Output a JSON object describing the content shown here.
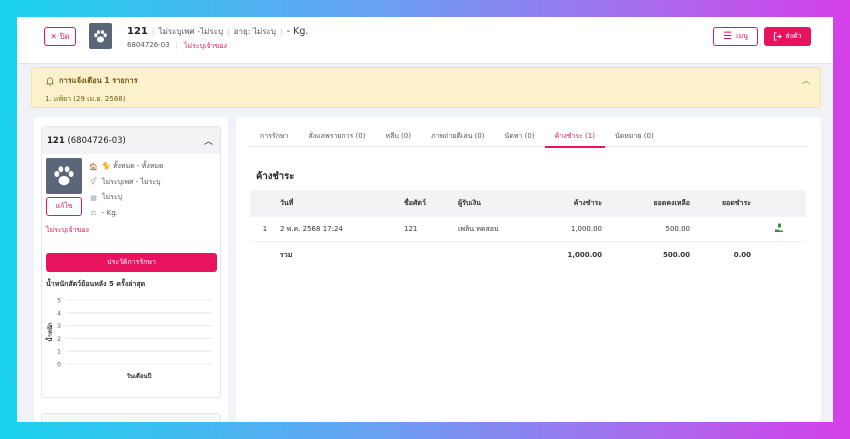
{
  "header": {
    "close_label": "ปิด",
    "pet_id": "121",
    "breed": "ไม่ระบุเพศ -ไม่ระบุ",
    "age": "อายุ: ไม่ระบุ",
    "weight": "- Kg.",
    "code": "6804726-03",
    "owner_status": "ไม่ระบุเจ้าของ",
    "menu_label": "เมนู",
    "send_label": "ส่งตัว"
  },
  "alert": {
    "title": "การแจ้งเตือน 1 รายการ",
    "item": "1. แพ้ยา (29 เม.ย. 2568)"
  },
  "pet_card": {
    "name": "121",
    "code": "(6804726-03)",
    "species": "🐈 ทั้งหมด - ทั้งหมด",
    "sex_breed": "ไม่ระบุเพศ - ไม่ระบุ",
    "age": "ไม่ระบุ",
    "weight": "- Kg.",
    "edit_label": "แก้ไข",
    "owner_status": "ไม่ระบุเจ้าของ",
    "history_button": "ประวัติการรักษา",
    "chart_title": "น้ำหนักสัตว์ย้อนหลัง 5 ครั้งล่าสุด"
  },
  "chart_data": {
    "type": "line",
    "title": "น้ำหนักสัตว์ย้อนหลัง 5 ครั้งล่าสุด",
    "xlabel": "วันเดือนปี",
    "ylabel": "น้ำหนัก",
    "ylim": [
      0,
      5
    ],
    "yticks": [
      "5",
      "4",
      "3",
      "2",
      "1",
      "0"
    ],
    "series": [],
    "grid": true
  },
  "tabs": [
    {
      "label": "การรักษา"
    },
    {
      "label": "สั่งแลพรายการ (0)"
    },
    {
      "label": "หลีบ (0)"
    },
    {
      "label": "ภาพถ่ายดีเล่น (0)"
    },
    {
      "label": "นัดหา (0)"
    },
    {
      "label": "ค้างชำระ (1)"
    },
    {
      "label": "นัดหมาย (0)"
    }
  ],
  "section_title": "ค้างชำระ",
  "table": {
    "headers": [
      "",
      "วันที่",
      "ชื่อศัตว์",
      "ผู้รับเงิน",
      "ค้างชำระ",
      "ยอดคงเหลือ",
      "ยอดชำระ",
      ""
    ],
    "rows": [
      {
        "no": "1",
        "date": "2 พ.ค. 2568 17:24",
        "pet": "121",
        "receiver": "เพลิน ทดสอบ",
        "outstanding": "1,000.00",
        "balance": "500.00"
      }
    ],
    "total": {
      "label": "รวม",
      "outstanding": "1,000.00",
      "balance": "500.00",
      "paid": "0.00"
    }
  },
  "colors": {
    "accent": "#e8135f",
    "alert_bg": "#fbf2cb"
  }
}
